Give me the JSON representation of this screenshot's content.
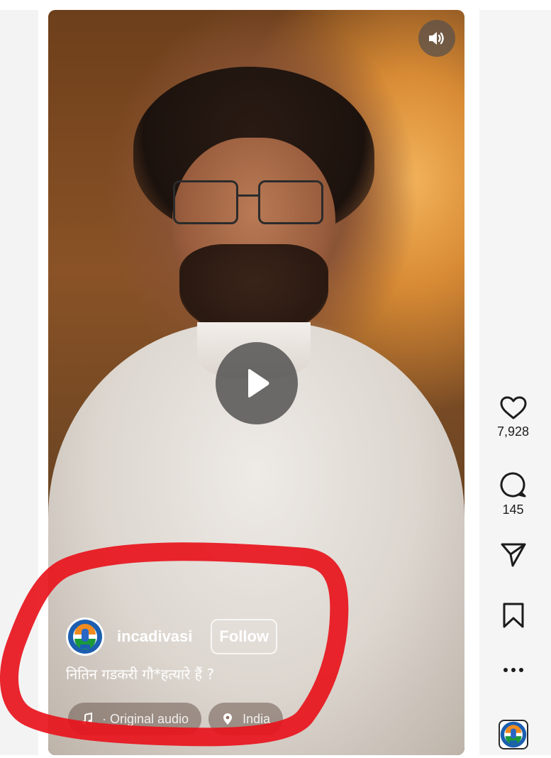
{
  "reel": {
    "author": {
      "username": "incadivasi",
      "follow_label": "Follow",
      "avatar_icon": "congress-hand-logo-icon"
    },
    "caption": "नितिन गडकरी गौ*हत्यारे हैं ?",
    "audio_label": "· Original audio",
    "location_label": "India",
    "controls": {
      "sound_icon": "speaker-on-icon",
      "play_icon": "play-icon"
    }
  },
  "actions": {
    "likes": "7,928",
    "comments": "145",
    "like_icon": "heart-icon",
    "comment_icon": "comment-bubble-icon",
    "share_icon": "paper-plane-icon",
    "save_icon": "bookmark-icon",
    "more_icon": "more-dots-icon",
    "audio_avatar_icon": "congress-hand-logo-icon"
  },
  "colors": {
    "annotation_red": "#e8141c",
    "text_dark": "#1c1c1c"
  }
}
